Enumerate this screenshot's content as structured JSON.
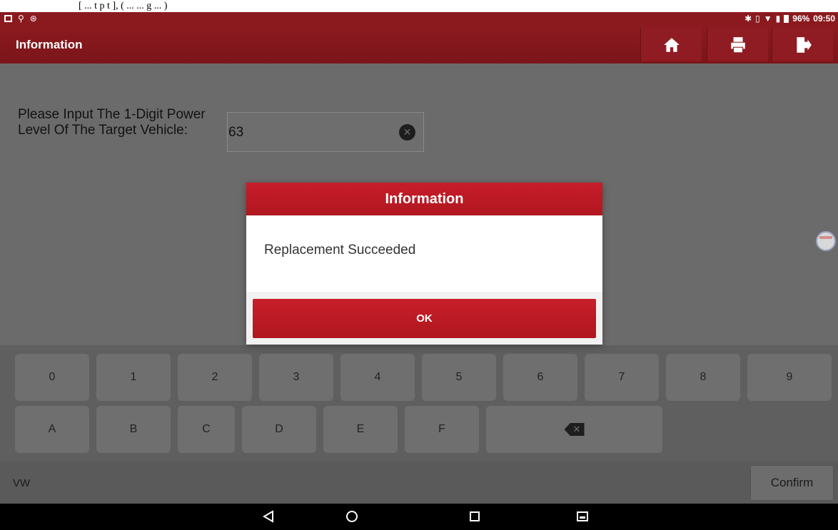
{
  "top_strip": {
    "text": "[ ... t   p    t   ], ( ... ...    g    ... )"
  },
  "status_bar": {
    "battery": "96%",
    "time": "09:50",
    "left_icons": [
      "image-icon",
      "usb-icon",
      "bluetooth-icon"
    ],
    "right_icons": [
      "bluetooth-icon",
      "vibrate-icon",
      "wifi-icon",
      "signal-icon",
      "battery-icon"
    ]
  },
  "app_bar": {
    "title": "Information",
    "buttons": [
      "home-icon",
      "print-icon",
      "exit-icon"
    ]
  },
  "form": {
    "prompt": "Please Input The 1-Digit Power Level Of The Target Vehicle:",
    "value": "63"
  },
  "keyboard": {
    "row1": [
      "0",
      "1",
      "2",
      "3",
      "4",
      "5",
      "6",
      "7",
      "8",
      "9"
    ],
    "row2": [
      "A",
      "B",
      "C",
      "D",
      "E",
      "F"
    ]
  },
  "bottom_bar": {
    "label": "VW",
    "confirm_label": "Confirm"
  },
  "dialog": {
    "title": "Information",
    "message": "Replacement Succeeded",
    "ok_label": "OK"
  },
  "colors": {
    "brand_dark": "#8b1a1f",
    "brand_red": "#c41e2a",
    "overlay_gray": "#6b6b6b"
  }
}
